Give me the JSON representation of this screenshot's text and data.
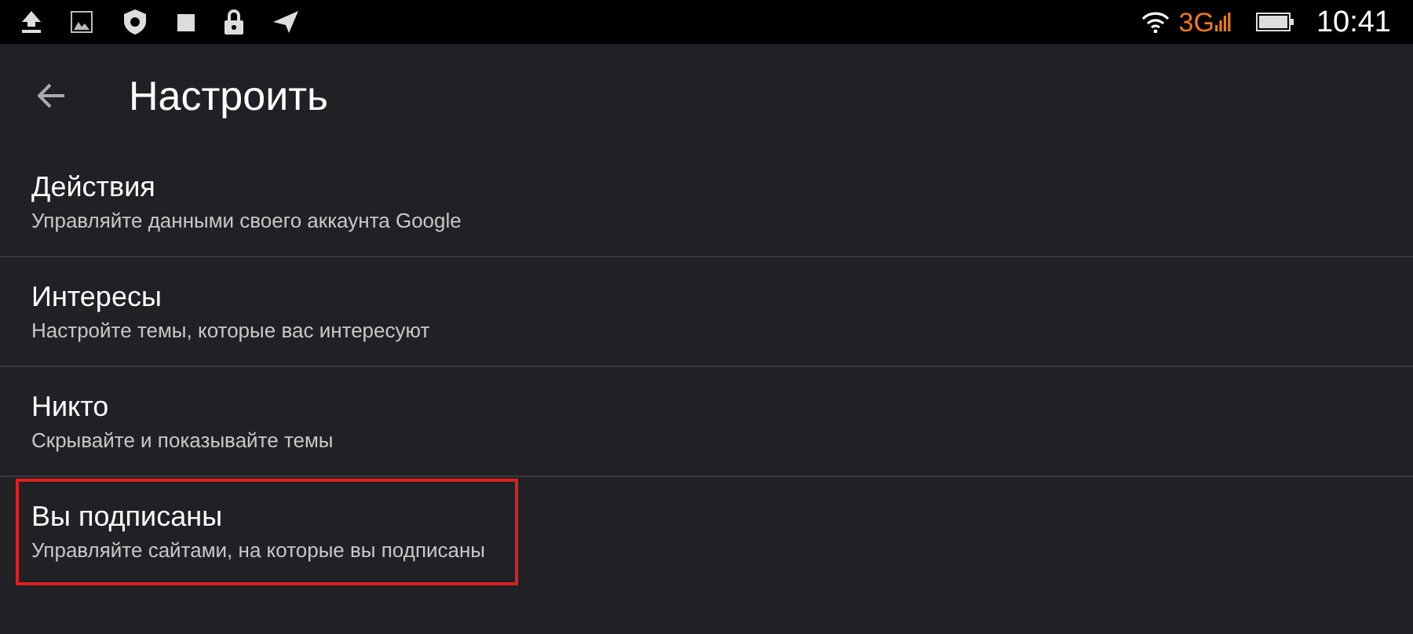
{
  "status_bar": {
    "network": "3G",
    "time": "10:41"
  },
  "header": {
    "title": "Настроить"
  },
  "items": [
    {
      "title": "Действия",
      "subtitle": "Управляйте данными своего аккаунта Google",
      "highlighted": false
    },
    {
      "title": "Интересы",
      "subtitle": "Настройте темы, которые вас интересуют",
      "highlighted": false
    },
    {
      "title": "Никто",
      "subtitle": "Скрывайте и показывайте темы",
      "highlighted": false
    },
    {
      "title": "Вы подписаны",
      "subtitle": "Управляйте сайтами, на которые вы подписаны",
      "highlighted": true
    }
  ]
}
